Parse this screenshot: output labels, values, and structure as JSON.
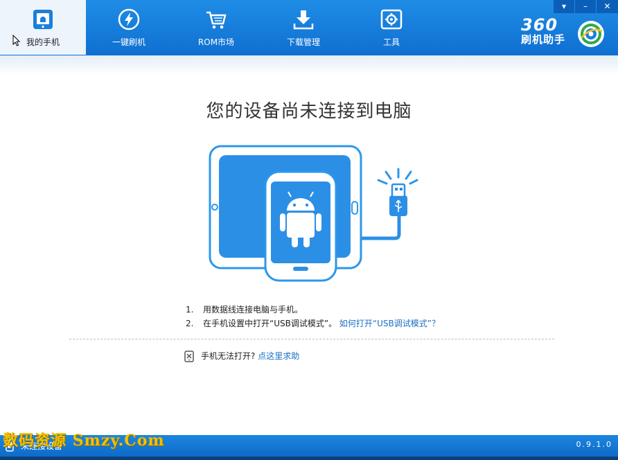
{
  "nav": {
    "tabs": [
      {
        "label": "我的手机",
        "icon": "phone-icon",
        "active": true
      },
      {
        "label": "一键刷机",
        "icon": "flash-icon",
        "active": false
      },
      {
        "label": "ROM市场",
        "icon": "cart-icon",
        "active": false
      },
      {
        "label": "下载管理",
        "icon": "download-icon",
        "active": false
      },
      {
        "label": "工具",
        "icon": "toolbox-icon",
        "active": false
      }
    ]
  },
  "window_controls": {
    "menu": "▾",
    "minimize": "–",
    "close": "✕"
  },
  "brand": {
    "number": "360",
    "name": "刷机助手"
  },
  "main": {
    "title": "您的设备尚未连接到电脑",
    "steps": [
      {
        "num": "1.",
        "text": "用数据线连接电脑与手机。"
      },
      {
        "num": "2.",
        "text": "在手机设置中打开“USB调试模式”。",
        "link": "如何打开“USB调试模式”？"
      }
    ],
    "help_text": "手机无法打开?",
    "help_link": "点这里求助"
  },
  "watermark": "数码资源 Smzy.Com",
  "status": {
    "text": "未连接设备",
    "version": "0.9.1.0"
  },
  "colors": {
    "primary": "#1a7fdd",
    "link": "#1a6fc4",
    "watermark": "#f3c000"
  }
}
